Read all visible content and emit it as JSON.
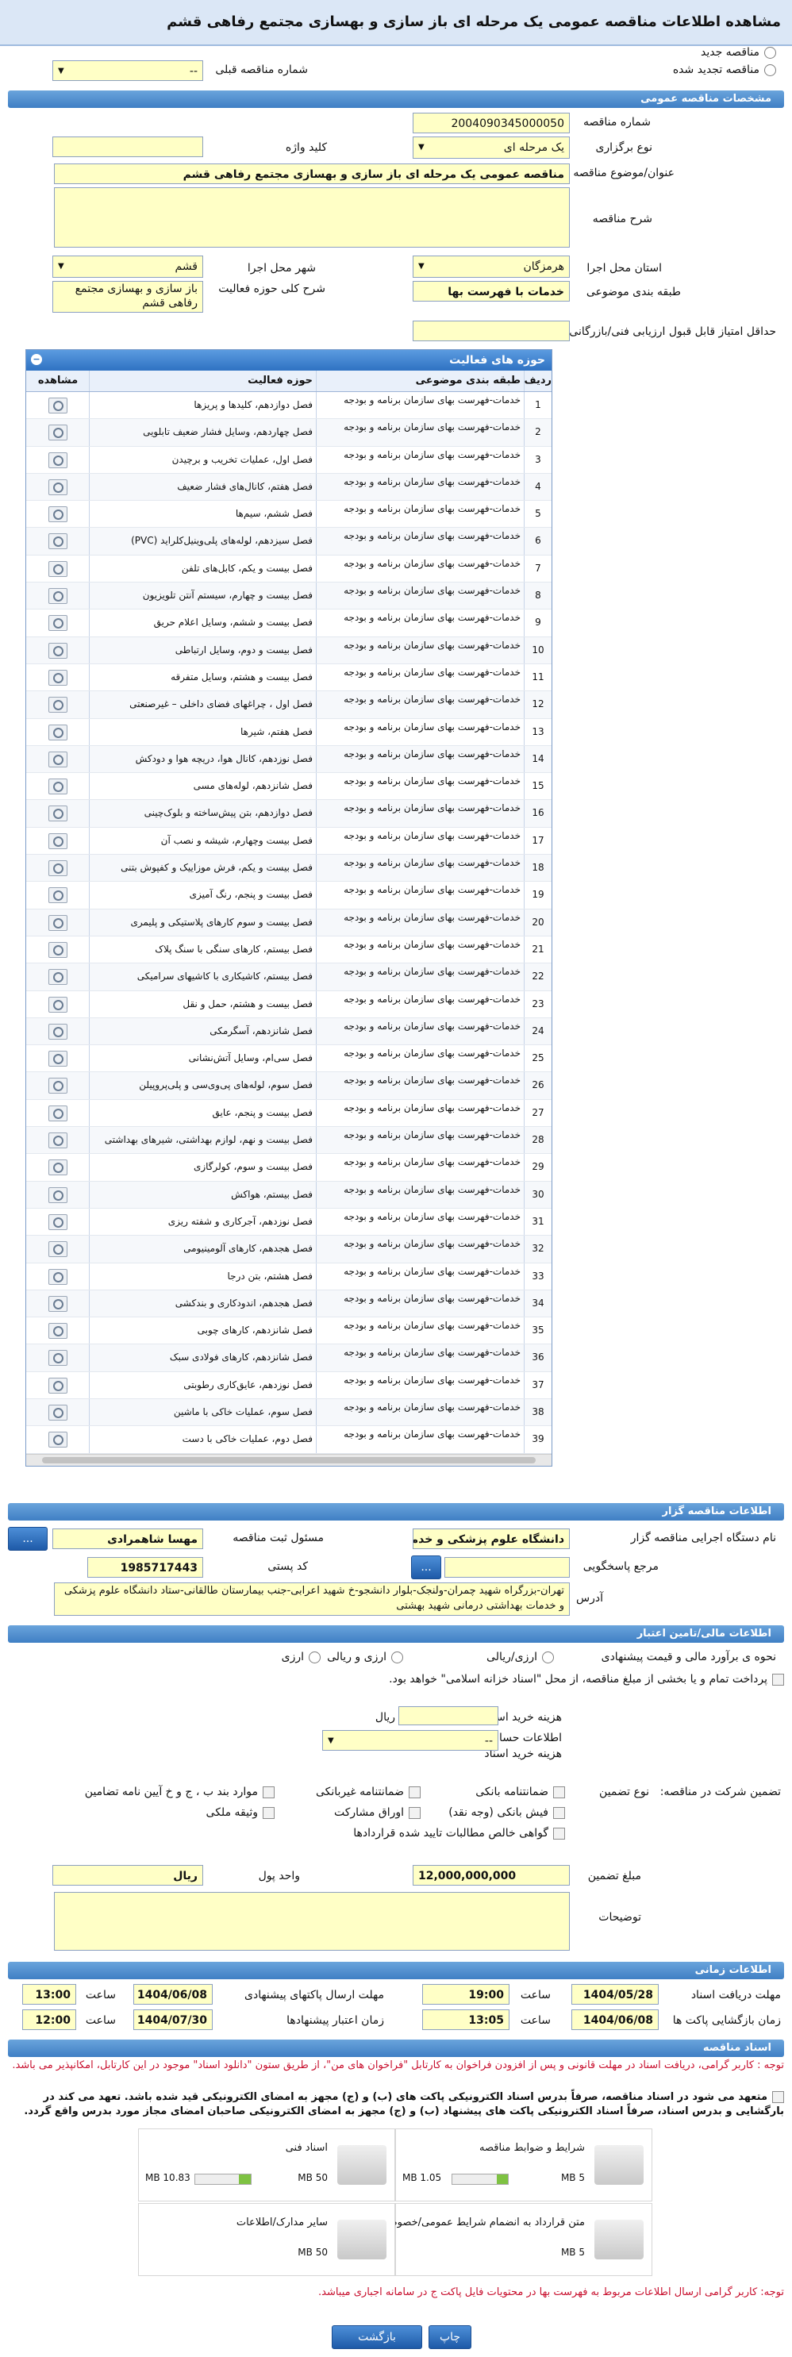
{
  "title": "مشاهده اطلاعات مناقصه عمومی یک مرحله ای باز سازی و بهسازی مجتمع رفاهی قشم",
  "top": {
    "new": "مناقصه جدید",
    "renewed": "مناقصه تجدید شده",
    "prev_label": "شماره مناقصه قبلی",
    "prev_value": "--"
  },
  "sections": {
    "general": "مشخصات مناقصه عمومی",
    "organizer": "اطلاعات مناقصه گزار",
    "finance": "اطلاعات مالی/تامین اعتبار",
    "timing": "اطلاعات زمانی",
    "docs": "اسناد مناقصه"
  },
  "general": {
    "number_label": "شماره مناقصه",
    "number": "2004090345000050",
    "type_label": "نوع برگزاری",
    "type": "یک مرحله ای",
    "keyword_label": "کلید واژه",
    "keyword": "",
    "subject_label": "عنوان/موضوع مناقصه",
    "subject": "مناقصه عمومی یک مرحله ای باز سازی و بهسازی مجتمع رفاهی قشم",
    "desc_label": "شرح مناقصه",
    "province_label": "استان محل اجرا",
    "province": "هرمزگان",
    "city_label": "شهر محل اجرا",
    "city": "قشم",
    "cat_label": "طبقه بندی موضوعی",
    "cat": "خدمات با فهرست بها",
    "scope_label": "شرح کلی حوزه فعالیت",
    "scope": "باز سازی و بهسازی مجتمع رفاهی قشم",
    "min_score_label": "حداقل امتیاز قابل قبول ارزیابی فنی/بازرگانی",
    "min_score": ""
  },
  "grid": {
    "title": "حوزه های فعالیت",
    "cols": [
      "ردیف",
      "طبقه بندی موضوعی",
      "حوزه فعالیت",
      "مشاهده"
    ],
    "cat": "خدمات-فهرست بهای سازمان برنامه و بودجه",
    "rows": [
      "فصل دوازدهم، کلیدها و پریزها",
      "فصل چهاردهم، وسایل فشار ضعیف تابلویی",
      "فصل اول، عملیات تخریب و برچیدن",
      "فصل هفتم، کانال‌های فشار ضعیف",
      "فصل ششم، سیم‌ها",
      "فصل سیزدهم، لوله‌های پلی‌وینیل‌کلراید (PVC)",
      "فصل بیست و یکم، کابل‌های تلفن",
      "فصل بیست و چهارم، سیستم آنتن تلویزیون",
      "فصل بیست و ششم، وسایل اعلام حریق",
      "فصل بیست و دوم، وسایل ارتباطی",
      "فصل بیست و هشتم، وسایل متفرقه",
      "فصل اول ، چراغهای فضای داخلی – غیرصنعتی",
      "فصل هفتم، شیرها",
      "فصل نوزدهم، کانال هوا، دریچه هوا و دودکش",
      "فصل شانزدهم، لوله‌های مسی",
      "فصل دوازدهم، بتن پیش‌ساخته و بلوک‌چینی",
      "فصل بیست وچهارم، شیشه و نصب آن",
      "فصل بیست و یکم، فرش موزاییک و کفپوش بتنی",
      "فصل بیست و پنجم، رنگ آمیزی",
      "فصل بیست و سوم کارهای پلاستیکی و پلیمری",
      "فصل بیستم، کارهای سنگی با سنگ پلاک",
      "فصل بیستم، کاشیکاری با کاشیهای سرامیکی",
      "فصل بیست و هشتم، حمل و نقل",
      "فصل شانزدهم، آسگرمکی",
      "فصل سی‌ام، وسایل آتش‌نشانی",
      "فصل سوم، لوله‌های پی‌وی‌سی و پلی‌پروپیلن",
      "فصل بیست و پنجم، عایق",
      "فصل بیست و نهم، لوازم بهداشتی، شیرهای بهداشتی",
      "فصل بیست و سوم، کولرگازی",
      "فصل بیستم، هواکش",
      "فصل نوزدهم، آجرکاری و شفته ریزی",
      "فصل هجدهم، کارهای آلومینیومی",
      "فصل هشتم، بتن درجا",
      "فصل هجدهم، اندودکاری و بندکشی",
      "فصل شانزدهم، کارهای چوبی",
      "فصل شانزدهم، کارهای فولادی سبک",
      "فصل نوزدهم، عایق‌کاری رطوبتی",
      "فصل سوم، عملیات خاکی با ماشین",
      "فصل دوم، عملیات خاکی با دست"
    ]
  },
  "org": {
    "device_label": "نام دستگاه اجرایی مناقصه گزار",
    "device": "دانشگاه علوم پزشکی و خدمات",
    "officer_label": "مسئول ثبت مناقصه",
    "officer": "مهسا شاهمرادی",
    "ref_label": "مرجع پاسخگویی",
    "ref": "",
    "postal_label": "کد پستی",
    "postal": "1985717443",
    "address_label": "آدرس",
    "address": "تهران-بزرگراه شهید چمران-ولنجک-بلوار دانشجو-خ شهید اعرابی-جنب بیمارستان طالقانی-ستاد دانشگاه علوم پزشکی و خدمات بهداشتی درمانی شهید بهشتی",
    "more": "..."
  },
  "fin": {
    "eval_label": "نحوه ی برآورد مالی و قیمت پیشنهادی",
    "eval_opts": [
      "ارزی/ریالی",
      "ارزی و ریالی",
      "ارزی"
    ],
    "pay_note": "پرداخت تمام و یا بخشی از مبلغ مناقصه، از محل \"اسناد خزانه اسلامی\" خواهد بود.",
    "doc_cost_label": "هزینه خرید اسناد",
    "doc_cost_unit": "ریال",
    "acc_label": "اطلاعات حساب جهت واریز هزینه خرید اسناد",
    "acc": "--",
    "guar_label": "تضمین شرکت در مناقصه:",
    "guar_type_label": "نوع تضمین",
    "guar_opts": [
      "ضمانتنامه بانکی",
      "ضمانتنامه غیربانکی",
      "موارد بند ب ، ج و خ آیین نامه تضامین",
      "فیش بانکی (وجه نقد)",
      "اوراق مشارکت",
      "وثیقه ملکی",
      "گواهی خالص مطالبات تایید شده قراردادها"
    ],
    "amount_label": "مبلغ تضمین",
    "amount": "12,000,000,000",
    "unit_label": "واحد پول",
    "unit": "ریال",
    "notes_label": "توضیحات"
  },
  "time": {
    "recv_label": "مهلت دریافت اسناد",
    "recv_date": "1404/05/28",
    "recv_time": "19:00",
    "send_label": "مهلت ارسال پاکتهای پیشنهادی",
    "send_date": "1404/06/08",
    "send_time": "13:00",
    "open_label": "زمان بازگشایی پاکت ها",
    "open_date": "1404/06/08",
    "open_time": "13:05",
    "valid_label": "زمان اعتبار پیشنهادها",
    "valid_date": "1404/07/30",
    "valid_time": "12:00",
    "time_label": "ساعت"
  },
  "docs": {
    "note1": "توجه : کاربر گرامی، دریافت اسناد در مهلت قانونی و پس از افزودن فراخوان به کارتابل \"فراخوان های من\"، از طریق ستون \"دانلود اسناد\" موجود در این کارتابل، امکانپذیر می باشد.",
    "note2": "متعهد می شود در اسناد مناقصه، صرفاً بدرس اسناد الکترونیکی پاکت های (ب) و (ج) مجهز به امضای الکترونیکی قید شده باشد. تعهد می کند در بارگشایی و بدرس اسناد، صرفاً اسناد الکترونیکی پاکت های پیشنهاد (ب) و (ج) مجهز به امضای الکترونیکی صاحبان امضای مجاز مورد بدرس واقع گردد.",
    "files": [
      {
        "name": "شرایط و ضوابط مناقصه",
        "used": "1.05 MB",
        "max": "5 MB",
        "pct": 20
      },
      {
        "name": "اسناد فنی",
        "used": "10.83 MB",
        "max": "50 MB",
        "pct": 22
      },
      {
        "name": "متن قرارداد به انضمام شرایط عمومی/خصوصی",
        "used": "",
        "max": "5 MB",
        "pct": 0
      },
      {
        "name": "سایر مدارک/اطلاعات",
        "used": "",
        "max": "50 MB",
        "pct": 0
      }
    ],
    "note3": "توجه: کاربر گرامی ارسال اطلاعات مربوط به فهرست بها در محتویات فایل پاکت ج در سامانه اجباری میباشد."
  },
  "buttons": {
    "print": "چاپ",
    "back": "بازگشت"
  }
}
